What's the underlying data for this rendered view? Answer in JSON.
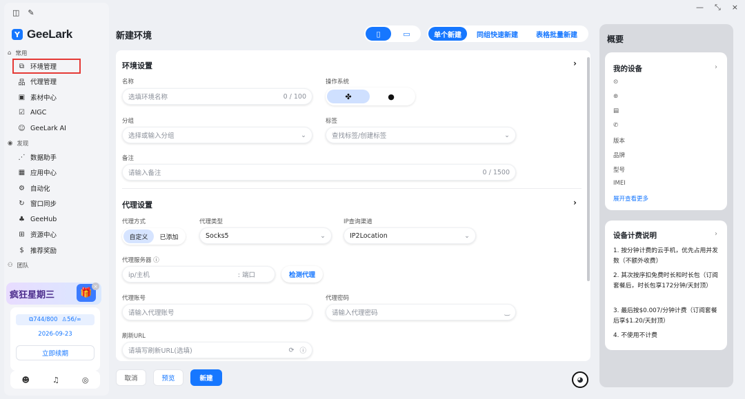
{
  "window": {
    "minimize": "—",
    "restore": "⤡",
    "close": "×"
  },
  "sidebar": {
    "logo_text": "GeeLark",
    "section_common": "常用",
    "section_discover": "发现",
    "section_team": "团队",
    "items_common": [
      {
        "label": "环境管理",
        "icon": "window-icon"
      },
      {
        "label": "代理管理",
        "icon": "network-icon"
      },
      {
        "label": "素材中心",
        "icon": "media-icon"
      },
      {
        "label": "AIGC",
        "icon": "ai-icon"
      },
      {
        "label": "GeeLark AI",
        "icon": "robot-icon"
      }
    ],
    "items_discover": [
      {
        "label": "数据助手",
        "icon": "chart-icon"
      },
      {
        "label": "应用中心",
        "icon": "grid-icon"
      },
      {
        "label": "自动化",
        "icon": "automation-icon"
      },
      {
        "label": "窗口同步",
        "icon": "sync-icon"
      },
      {
        "label": "GeeHub",
        "icon": "hub-icon"
      },
      {
        "label": "资源中心",
        "icon": "resource-icon"
      },
      {
        "label": "推荐奖励",
        "icon": "dollar-icon"
      }
    ],
    "promo_title": "疯狂星期三",
    "quota_devices": "744/800",
    "quota_users": "56/∞",
    "expire_date": "2026-09-23",
    "renew_label": "立即续期"
  },
  "header": {
    "title": "新建环境",
    "tabs": [
      "单个新建",
      "同组快速新建",
      "表格批量新建"
    ]
  },
  "env_settings": {
    "title": "环境设置",
    "name_label": "名称",
    "name_placeholder": "选填环境名称",
    "name_counter": "0 / 100",
    "os_label": "操作系统",
    "group_label": "分组",
    "group_placeholder": "选择或输入分组",
    "tag_label": "标签",
    "tag_placeholder": "查找标签/创建标签",
    "remark_label": "备注",
    "remark_placeholder": "请输入备注",
    "remark_counter": "0 / 1500"
  },
  "proxy_settings": {
    "title": "代理设置",
    "method_label": "代理方式",
    "method_options": [
      "自定义",
      "已添加"
    ],
    "type_label": "代理类型",
    "type_value": "Socks5",
    "channel_label": "IP查询渠道",
    "channel_value": "IP2Location",
    "server_label": "代理服务器",
    "host_placeholder": "ip/主机",
    "port_placeholder": ": 端口",
    "detect_label": "检测代理",
    "account_label": "代理账号",
    "account_placeholder": "请输入代理账号",
    "password_label": "代理密码",
    "password_placeholder": "请输入代理密码",
    "refresh_label": "刷新URL",
    "refresh_placeholder": "请填写刷新URL(选填)"
  },
  "footer": {
    "cancel": "取消",
    "preview": "预览",
    "create": "新建"
  },
  "overview": {
    "title": "概要",
    "my_devices_title": "我的设备",
    "device_fields": [
      "版本",
      "品牌",
      "型号",
      "IMEI"
    ],
    "more_link": "展开查看更多",
    "billing_title": "设备计费说明",
    "billing_items": [
      "1. 按分钟计费的云手机，优先占用并发数（不额外收费）",
      "2. 其次按序扣免费时长和时长包（订阅套餐后，时长包享172分钟/天封顶）",
      "3. 最后按$0.007/分钟计费（订阅套餐后享$1.20/天封顶）",
      "4. 不使用不计费"
    ]
  },
  "colors": {
    "accent": "#1677ff",
    "highlight_border": "#e53935"
  }
}
